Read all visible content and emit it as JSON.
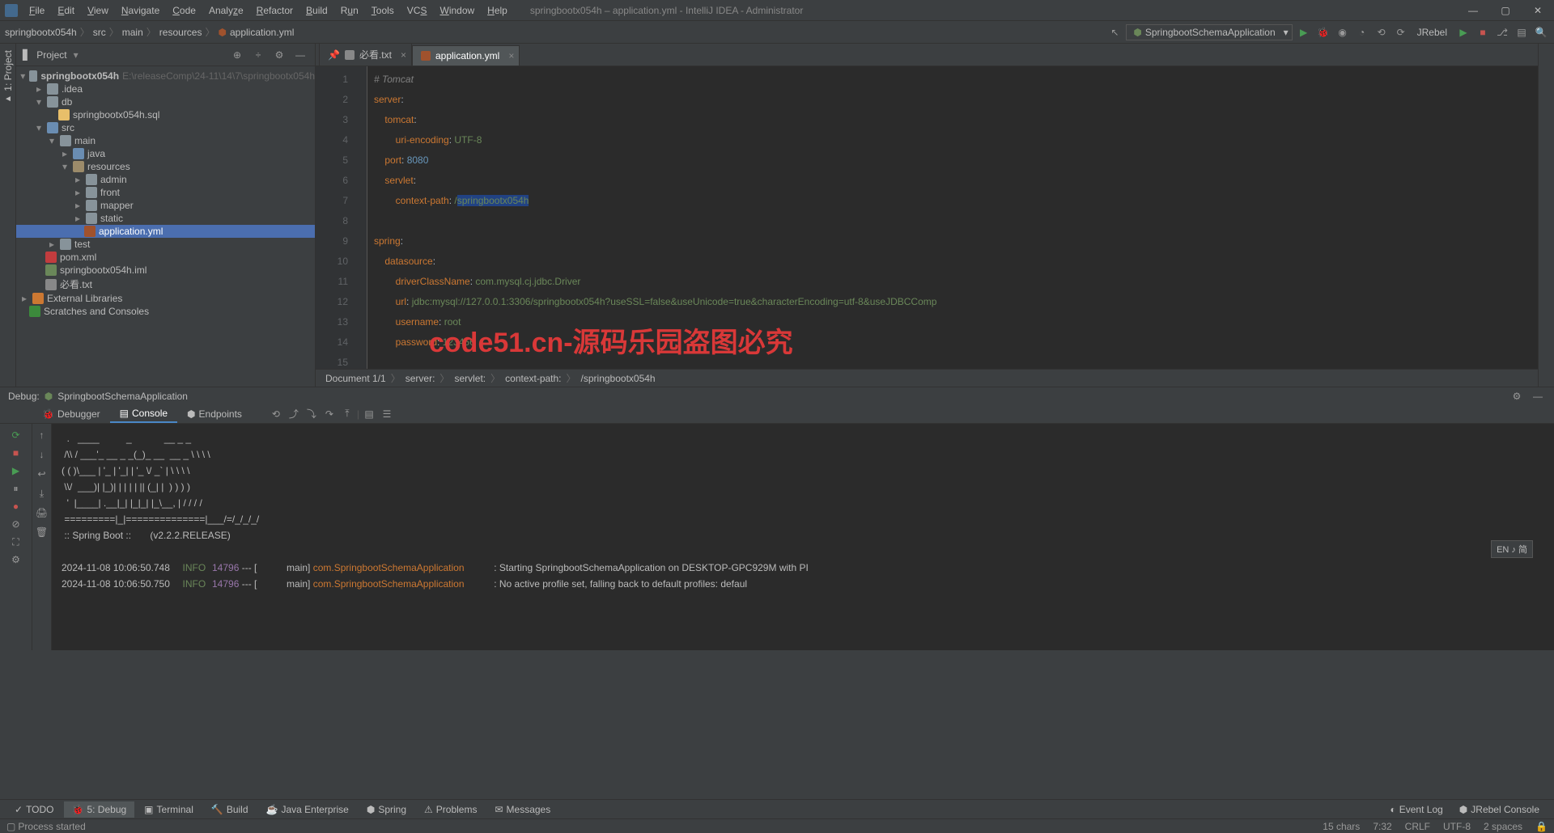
{
  "title": "springbootx054h – application.yml - IntelliJ IDEA - Administrator",
  "menu": [
    "File",
    "Edit",
    "View",
    "Navigate",
    "Code",
    "Analyze",
    "Refactor",
    "Build",
    "Run",
    "Tools",
    "VCS",
    "Window",
    "Help"
  ],
  "breadcrumb": [
    "springbootx054h",
    "src",
    "main",
    "resources",
    "application.yml"
  ],
  "run_config": "SpringbootSchemaApplication",
  "jrebel": "JRebel",
  "project_panel": {
    "title": "Project"
  },
  "tree": {
    "root": {
      "name": "springbootx054h",
      "path": "E:\\releaseComp\\24-11\\14\\7\\springbootx054h"
    },
    "idea": ".idea",
    "db": "db",
    "sql": "springbootx054h.sql",
    "src": "src",
    "main": "main",
    "java": "java",
    "resources": "resources",
    "admin": "admin",
    "front": "front",
    "mapper": "mapper",
    "static": "static",
    "appyml": "application.yml",
    "test": "test",
    "pom": "pom.xml",
    "iml": "springbootx054h.iml",
    "bk": "必看.txt",
    "ext": "External Libraries",
    "scratch": "Scratches and Consoles"
  },
  "editor_tabs": [
    {
      "label": "必看.txt",
      "active": false
    },
    {
      "label": "application.yml",
      "active": true
    }
  ],
  "code": {
    "l1": "# Tomcat",
    "l2k": "server",
    "l2c": ":",
    "l3k": "tomcat",
    "l3c": ":",
    "l4k": "uri-encoding",
    "l4c": ": ",
    "l4v": "UTF-8",
    "l5k": "port",
    "l5c": ": ",
    "l5v": "8080",
    "l6k": "servlet",
    "l6c": ":",
    "l7k": "context-path",
    "l7c": ": ",
    "l7v": "/",
    "l7sel": "springbootx054h",
    "l9k": "spring",
    "l9c": ":",
    "l10k": "datasource",
    "l10c": ":",
    "l11k": "driverClassName",
    "l11c": ": ",
    "l11v": "com.mysql.cj.jdbc.Driver",
    "l12k": "url",
    "l12c": ": ",
    "l12v": "jdbc:mysql://127.0.0.1:3306/springbootx054h?useSSL=false&useUnicode=true&characterEncoding=utf-8&useJDBCComp",
    "l13k": "username",
    "l13c": ": ",
    "l13v": "root",
    "l14k": "password",
    "l14c": ": ",
    "l14v": "123456"
  },
  "line_numbers": [
    "1",
    "2",
    "3",
    "4",
    "5",
    "6",
    "7",
    "8",
    "9",
    "10",
    "11",
    "12",
    "13",
    "14",
    "15"
  ],
  "breadcrumb_bar": {
    "doc": "Document 1/1",
    "p1": "server:",
    "p2": "servlet:",
    "p3": "context-path:",
    "p4": "/springbootx054h"
  },
  "debug": {
    "label": "Debug:",
    "app": "SpringbootSchemaApplication",
    "tabs": [
      "Debugger",
      "Console",
      "Endpoints"
    ]
  },
  "console": {
    "ascii": "  .   ____          _            __ _ _\n /\\\\ / ___'_ __ _ _(_)_ __  __ _ \\ \\ \\ \\\n( ( )\\___ | '_ | '_| | '_ \\/ _` | \\ \\ \\ \\\n \\\\/  ___)| |_)| | | | | || (_| |  ) ) ) )\n  '  |____| .__|_| |_|_| |_\\__, | / / / /\n =========|_|==============|___/=/_/_/_/\n :: Spring Boot ::       (v2.2.2.RELEASE)\n",
    "log1_ts": "2024-11-08 10:06:50.748",
    "log1_lvl": "INFO",
    "log1_pid": "14796",
    "log1_sep": " --- [",
    "log1_th": "           main] ",
    "log1_cls": "com.SpringbootSchemaApplication",
    "log1_msg": "           : Starting SpringbootSchemaApplication on DESKTOP-GPC929M with PI",
    "log2_ts": "2024-11-08 10:06:50.750",
    "log2_lvl": "INFO",
    "log2_pid": "14796",
    "log2_sep": " --- [",
    "log2_th": "           main] ",
    "log2_cls": "com.SpringbootSchemaApplication",
    "log2_msg": "           : No active profile set, falling back to default profiles: defaul"
  },
  "bottom_tabs": {
    "todo": "TODO",
    "debug": "5: Debug",
    "terminal": "Terminal",
    "build": "Build",
    "javaee": "Java Enterprise",
    "spring": "Spring",
    "problems": "Problems",
    "messages": "Messages",
    "eventlog": "Event Log",
    "jrebel": "JRebel Console"
  },
  "status": {
    "left": "Process started",
    "chars": "15 chars",
    "pos": "7:32",
    "crlf": "CRLF",
    "enc": "UTF-8",
    "spaces": "2 spaces"
  },
  "watermark": "code51.cn-源码乐园盗图必究",
  "wm_faint": "code51.cn",
  "lang_ind": "EN ♪ 简"
}
